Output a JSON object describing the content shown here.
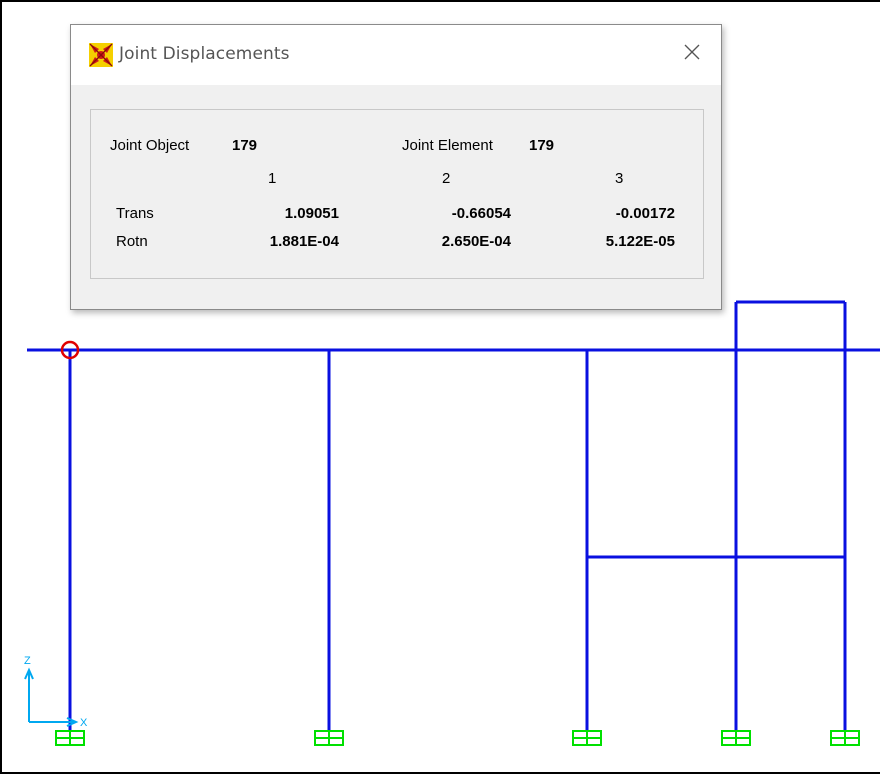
{
  "dialog": {
    "title": "Joint Displacements",
    "icon": "sap2000-app-icon",
    "close_icon": "close-icon",
    "joint_object_label": "Joint Object",
    "joint_object_value": "179",
    "joint_element_label": "Joint Element",
    "joint_element_value": "179",
    "columns": [
      "1",
      "2",
      "3"
    ],
    "rows": [
      {
        "label": "Trans",
        "values": [
          "1.09051",
          "-0.66054",
          "-0.00172"
        ]
      },
      {
        "label": "Rotn",
        "values": [
          "1.881E-04",
          "2.650E-04",
          "5.122E-05"
        ]
      }
    ]
  },
  "model_view": {
    "frame_color": "#0a10e0",
    "support_color": "#00e000",
    "selection_color": "#e00000",
    "axis_color": "#00a8f0",
    "axis_z_label": "Z",
    "axis_x_label": "X"
  }
}
